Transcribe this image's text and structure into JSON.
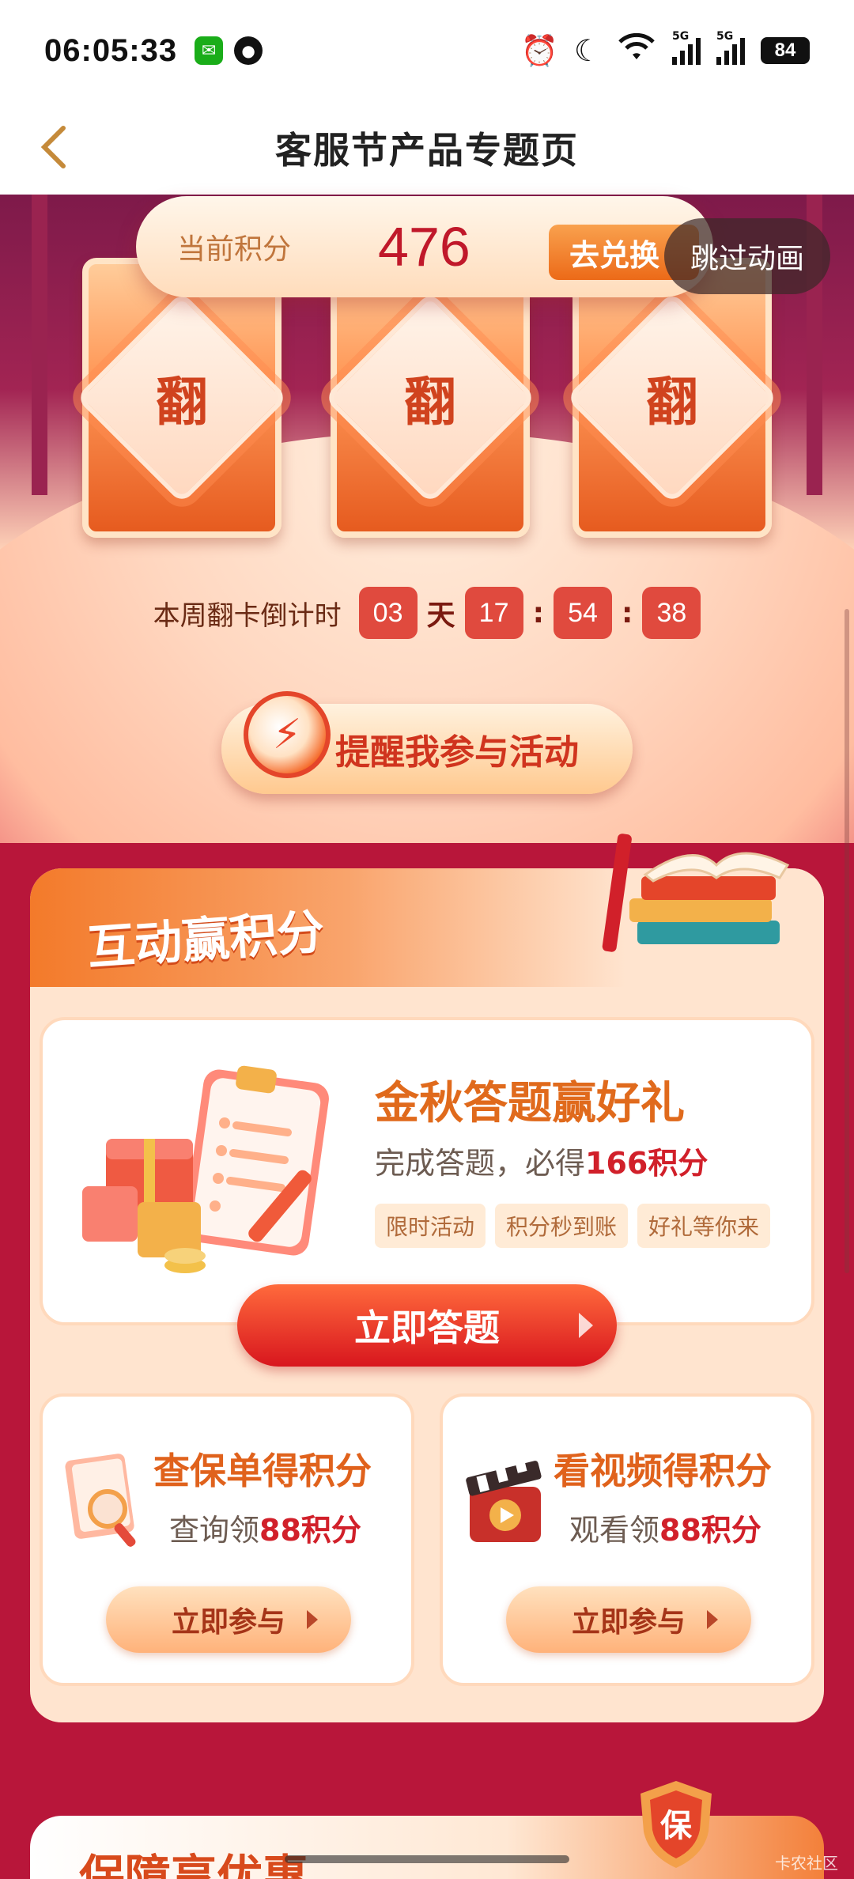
{
  "status_bar": {
    "time": "06:05:33",
    "battery": "84",
    "network_tags": [
      "5G",
      "5G"
    ]
  },
  "nav": {
    "title": "客服节产品专题页"
  },
  "banner": {
    "points_label": "当前积分",
    "points_value": "476",
    "redeem_label": "去兑换",
    "skip_label": "跳过动画",
    "cards": [
      "翻",
      "翻",
      "翻"
    ],
    "countdown": {
      "label": "本周翻卡倒计时",
      "days": "03",
      "day_unit": "天",
      "hours": "17",
      "minutes": "54",
      "seconds": "38",
      "separator": ":"
    },
    "reminder_label": "提醒我参与活动"
  },
  "interactive_section": {
    "title": "互动赢积分",
    "quiz": {
      "title": "金秋答题赢好礼",
      "sub_prefix": "完成答题，必得",
      "sub_points": "166积分",
      "tags": [
        "限时活动",
        "积分秒到账",
        "好礼等你来"
      ],
      "button": "立即答题"
    },
    "cards": [
      {
        "title": "查保单得积分",
        "text_prefix": "查询领",
        "points": "88积分",
        "button": "立即参与"
      },
      {
        "title": "看视频得积分",
        "text_prefix": "观看领",
        "points": "88积分",
        "button": "立即参与"
      }
    ]
  },
  "section2": {
    "title": "保障享优惠",
    "shield_char": "保"
  },
  "watermark": "卡农社区",
  "colors": {
    "primary_red": "#d1202a",
    "accent_orange": "#e0621c",
    "background": "#b8163a"
  }
}
